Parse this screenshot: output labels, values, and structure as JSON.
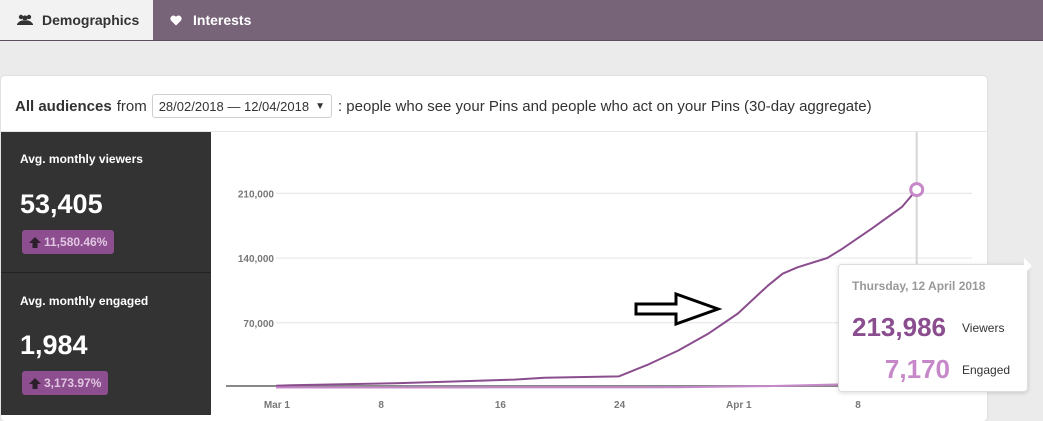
{
  "tabs": [
    {
      "label": "Demographics",
      "icon": "users-icon",
      "active": true
    },
    {
      "label": "Interests",
      "icon": "heart-icon",
      "active": false
    }
  ],
  "header": {
    "audience": "All audiences",
    "from": "from",
    "date_range": "28/02/2018 — 12/04/2018",
    "description": ": people who see your Pins and people who act on your Pins (30-day aggregate)"
  },
  "metrics": {
    "viewers": {
      "label": "Avg. monthly viewers",
      "value": "53,405",
      "change": "11,580.46%"
    },
    "engaged": {
      "label": "Avg. monthly engaged",
      "value": "1,984",
      "change": "3,173.97%"
    }
  },
  "tooltip": {
    "date": "Thursday, 12 April 2018",
    "viewers_value": "213,986",
    "viewers_label": "Viewers",
    "engaged_value": "7,170",
    "engaged_label": "Engaged"
  },
  "colors": {
    "topbar": "#786478",
    "viewers_line": "#8a4d8e",
    "engaged_line": "#c688c9",
    "badge": "#8d4e8f"
  },
  "chart_data": {
    "type": "line",
    "x_ticks": [
      "Mar 1",
      "8",
      "16",
      "24",
      "Apr 1",
      "8"
    ],
    "y_ticks": [
      "70,000",
      "140,000",
      "210,000"
    ],
    "ylim": [
      0,
      230000
    ],
    "grid": true,
    "series": [
      {
        "name": "Viewers",
        "x": [
          "2018-02-28",
          "2018-03-01",
          "2018-03-08",
          "2018-03-13",
          "2018-03-16",
          "2018-03-18",
          "2018-03-23",
          "2018-03-25",
          "2018-03-27",
          "2018-03-29",
          "2018-03-31",
          "2018-04-02",
          "2018-04-03",
          "2018-04-04",
          "2018-04-06",
          "2018-04-07",
          "2018-04-09",
          "2018-04-11",
          "2018-04-12"
        ],
        "values": [
          2000,
          2500,
          4500,
          7000,
          8500,
          10500,
          12000,
          25000,
          40000,
          58000,
          80000,
          110000,
          123000,
          130000,
          140000,
          150000,
          172000,
          195000,
          213986
        ]
      },
      {
        "name": "Engaged",
        "x": [
          "2018-02-28",
          "2018-03-16",
          "2018-03-27",
          "2018-04-02",
          "2018-04-08",
          "2018-04-12"
        ],
        "values": [
          0,
          100,
          200,
          1500,
          3800,
          7170
        ]
      }
    ]
  }
}
